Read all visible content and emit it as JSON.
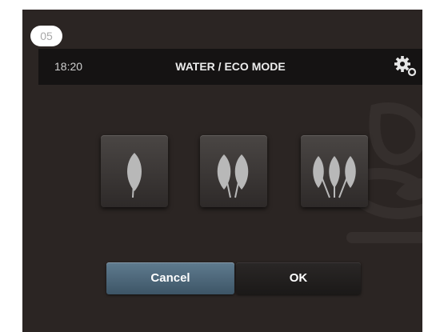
{
  "step_badge": "05",
  "header": {
    "time": "18:20",
    "title": "WATER / ECO MODE",
    "settings_icon": "gear-icon"
  },
  "eco_levels": [
    {
      "icon": "leaf-icon",
      "leaves": 1
    },
    {
      "icon": "leaf-icon",
      "leaves": 2
    },
    {
      "icon": "leaf-icon",
      "leaves": 3
    }
  ],
  "actions": {
    "cancel_label": "Cancel",
    "ok_label": "OK"
  },
  "colors": {
    "screen_bg": "#2b2523",
    "topbar_bg": "#151313",
    "cancel_accent": "#4d6a7e",
    "leaf": "#b8b8b8"
  }
}
